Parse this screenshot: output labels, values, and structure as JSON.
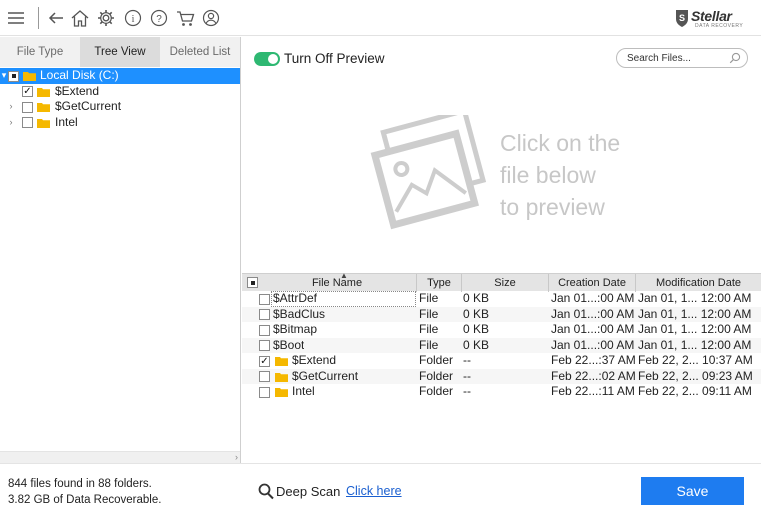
{
  "toolbar": {
    "icons": [
      "menu-icon",
      "back-icon",
      "home-icon",
      "gear-icon",
      "info-icon",
      "help-icon",
      "cart-icon",
      "user-icon"
    ],
    "logo_text": "Stellar",
    "logo_subtext": "DATA RECOVERY"
  },
  "left_panel": {
    "tabs": [
      {
        "label": "File Type",
        "active": false
      },
      {
        "label": "Tree View",
        "active": true
      },
      {
        "label": "Deleted List",
        "active": false
      }
    ],
    "tree": [
      {
        "label": "Local Disk (C:)",
        "checked": "partial",
        "expanded": true,
        "selected": true,
        "level": 0
      },
      {
        "label": "$Extend",
        "checked": "checked",
        "expanded": false,
        "selected": false,
        "level": 1
      },
      {
        "label": "$GetCurrent",
        "checked": "unchecked",
        "expanded": false,
        "selected": false,
        "level": 1
      },
      {
        "label": "Intel",
        "checked": "unchecked",
        "expanded": false,
        "selected": false,
        "level": 1
      }
    ]
  },
  "preview": {
    "toggle_label": "Turn Off Preview",
    "toggle_on": true,
    "search_placeholder": "Search Files...",
    "placeholder_lines": [
      "Click on the",
      "file below",
      "to preview"
    ]
  },
  "file_table": {
    "headers": [
      "File Name",
      "Type",
      "Size",
      "Creation Date",
      "Modification Date"
    ],
    "rows": [
      {
        "name": "$AttrDef",
        "type": "File",
        "size": "0 KB",
        "created": "Jan 01...:00 AM",
        "modified": "Jan 01, 1... 12:00 AM",
        "checked": false,
        "folder": false
      },
      {
        "name": "$BadClus",
        "type": "File",
        "size": "0 KB",
        "created": "Jan 01...:00 AM",
        "modified": "Jan 01, 1... 12:00 AM",
        "checked": false,
        "folder": false
      },
      {
        "name": "$Bitmap",
        "type": "File",
        "size": "0 KB",
        "created": "Jan 01...:00 AM",
        "modified": "Jan 01, 1... 12:00 AM",
        "checked": false,
        "folder": false
      },
      {
        "name": "$Boot",
        "type": "File",
        "size": "0 KB",
        "created": "Jan 01...:00 AM",
        "modified": "Jan 01, 1... 12:00 AM",
        "checked": false,
        "folder": false
      },
      {
        "name": "$Extend",
        "type": "Folder",
        "size": "--",
        "created": "Feb 22...:37 AM",
        "modified": "Feb 22, 2... 10:37 AM",
        "checked": true,
        "folder": true
      },
      {
        "name": "$GetCurrent",
        "type": "Folder",
        "size": "--",
        "created": "Feb 22...:02 AM",
        "modified": "Feb 22, 2... 09:23 AM",
        "checked": false,
        "folder": true
      },
      {
        "name": "Intel",
        "type": "Folder",
        "size": "--",
        "created": "Feb 22...:11 AM",
        "modified": "Feb 22, 2... 09:11 AM",
        "checked": false,
        "folder": true
      }
    ]
  },
  "footer": {
    "files_found": "844 files found in 88 folders.",
    "data_recoverable": "3.82 GB of Data Recoverable.",
    "deep_scan_label": "Deep Scan",
    "deep_scan_link": "Click here",
    "save_label": "Save"
  },
  "colors": {
    "accent_blue": "#1e7cf0",
    "selection_blue": "#1e90ff",
    "toggle_green": "#2eb872",
    "folder_yellow": "#f5b800"
  }
}
